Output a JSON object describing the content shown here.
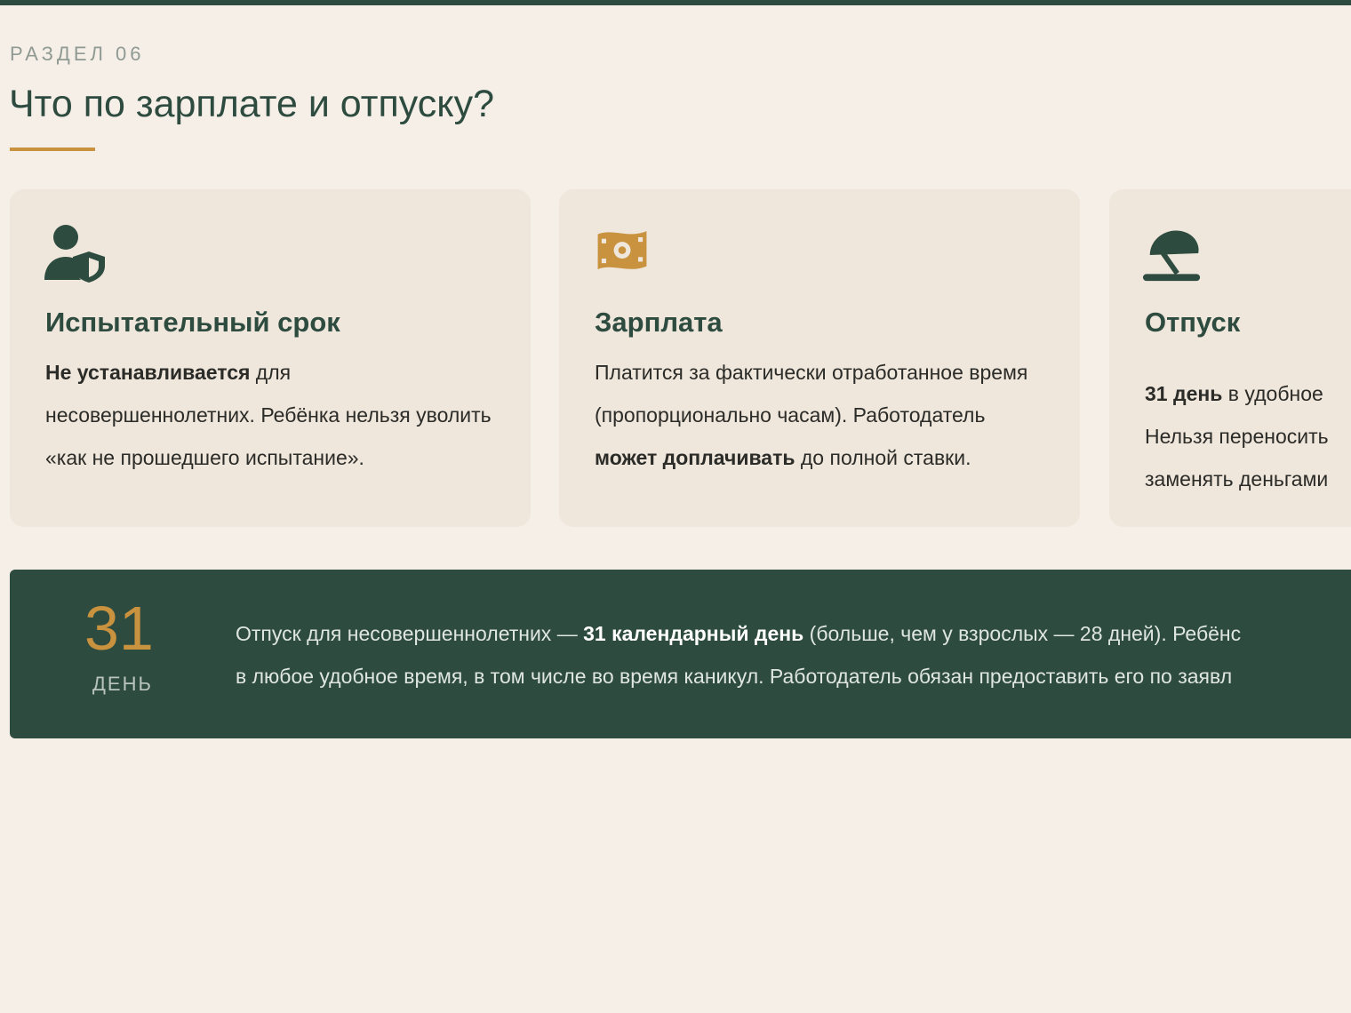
{
  "section": {
    "label": "РАЗДЕЛ 06",
    "title": "Что по зарплате и отпуску?"
  },
  "cards": [
    {
      "icon": "user-shield-icon",
      "title": "Испытательный срок",
      "text_bold_1": "Не устанавливается",
      "text_1": " для несовершеннолетних. Ребёнка нельзя уволить «как не прошедшего испытание»."
    },
    {
      "icon": "money-bill-icon",
      "title": "Зарплата",
      "text_1": "Платится за фактически отработанное время (пропорционально часам). Работодатель ",
      "text_bold_1": "может доплачивать",
      "text_2": " до полной ставки."
    },
    {
      "icon": "umbrella-beach-icon",
      "title": "Отпуск",
      "text_bold_1": "31 день",
      "text_1": " в удобное ",
      "text_2": "Нельзя переносить",
      "text_3": "заменять деньгами"
    }
  ],
  "banner": {
    "number": "31",
    "unit": "ДЕНЬ",
    "line1_a": "Отпуск для несовершеннолетних — ",
    "line1_bold": "31 календарный день",
    "line1_b": " (больше, чем у взрослых — 28 дней). Ребёнс",
    "line2": "в любое удобное время, в том числе во время каникул. Работодатель обязан предоставить его по заявл"
  },
  "colors": {
    "primary": "#2e4b40",
    "accent": "#c9923e",
    "background": "#f6efe8",
    "card": "#efe6dc"
  }
}
